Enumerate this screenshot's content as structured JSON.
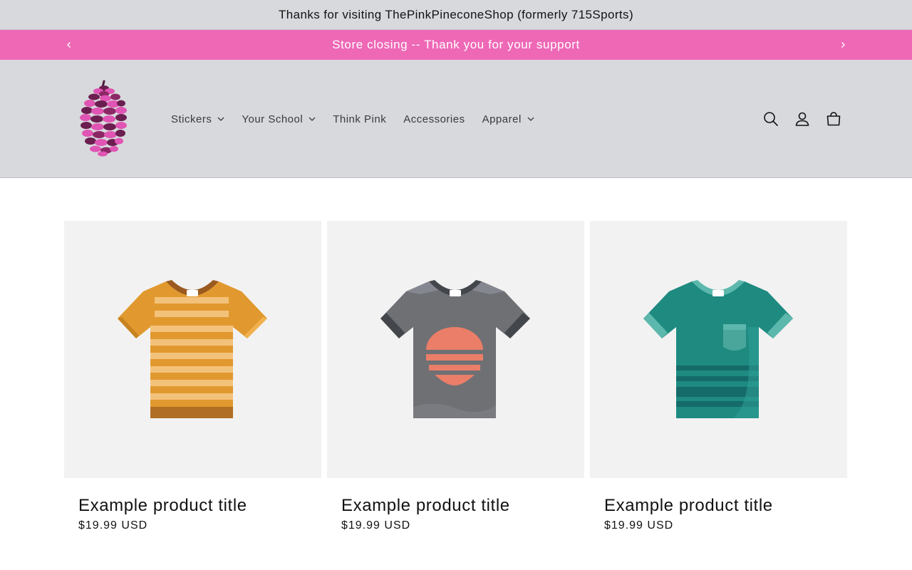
{
  "top_bar": {
    "text": "Thanks for visiting ThePinkPineconeShop (formerly 715Sports)"
  },
  "announcement": {
    "text": "Store closing -- Thank you for your support",
    "background": "#ee68b6",
    "prev_icon": "chevron-left-icon",
    "next_icon": "chevron-right-icon"
  },
  "header": {
    "logo": "pink-pinecone-logo",
    "nav": [
      {
        "label": "Stickers",
        "has_dropdown": true
      },
      {
        "label": "Your School",
        "has_dropdown": true
      },
      {
        "label": "Think Pink",
        "has_dropdown": false
      },
      {
        "label": "Accessories",
        "has_dropdown": false
      },
      {
        "label": "Apparel",
        "has_dropdown": true
      }
    ],
    "icons": [
      "search-icon",
      "account-icon",
      "cart-icon"
    ]
  },
  "products": [
    {
      "title": "Example product title",
      "price": "$19.99 USD",
      "image": "orange-striped-tshirt",
      "color": "#e1992f"
    },
    {
      "title": "Example product title",
      "price": "$19.99 USD",
      "image": "gray-sunset-tshirt",
      "color": "#6e7074"
    },
    {
      "title": "Example product title",
      "price": "$19.99 USD",
      "image": "teal-pocket-tshirt",
      "color": "#1e8a80"
    }
  ]
}
